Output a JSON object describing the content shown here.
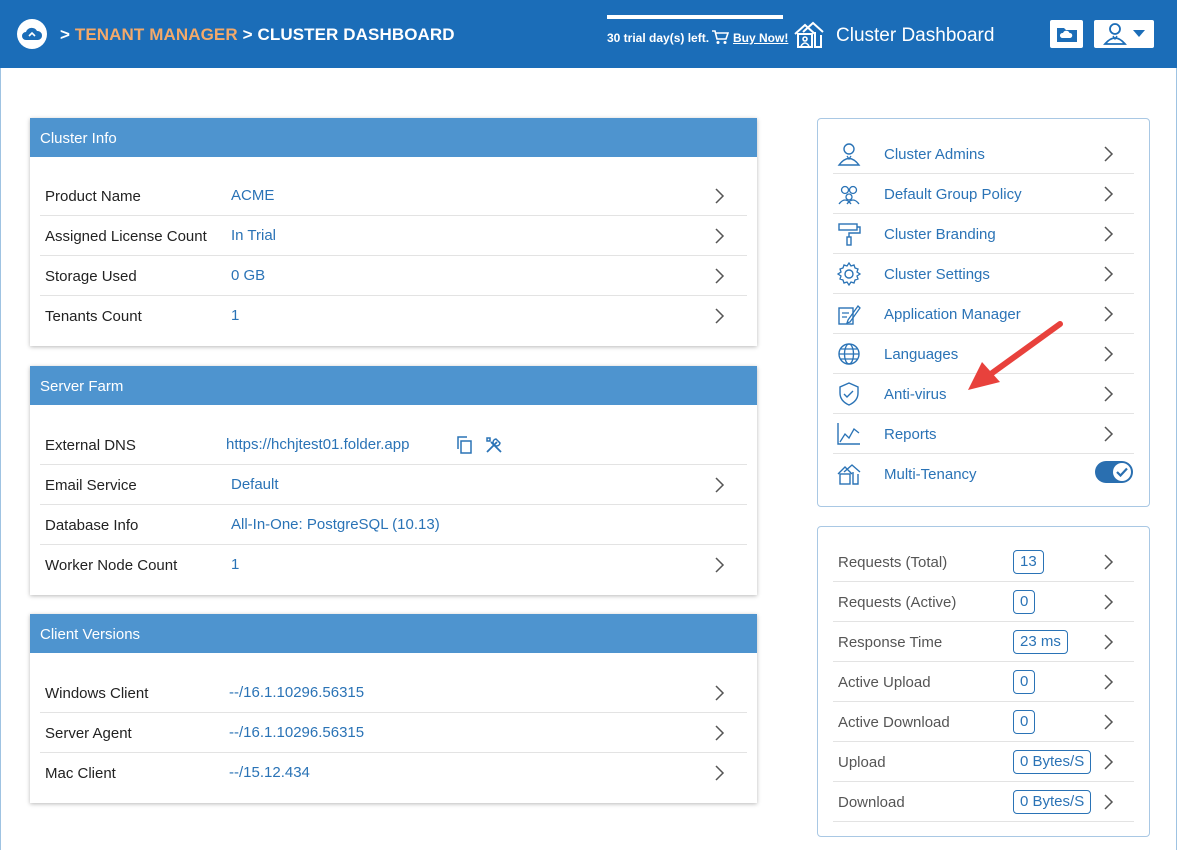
{
  "header": {
    "breadcrumb_sep1": ">",
    "breadcrumb_parent": "TENANT MANAGER",
    "breadcrumb_sep2": ">",
    "breadcrumb_current": "CLUSTER DASHBOARD",
    "trial_text": "30 trial day(s) left.",
    "buy_label": "Buy Now!",
    "title": "Cluster Dashboard",
    "icons": [
      "cloud-logo-icon",
      "cart-icon",
      "house-icon",
      "folder-icon",
      "user-icon",
      "caret-down-icon"
    ]
  },
  "cluster_info": {
    "title": "Cluster Info",
    "rows": [
      {
        "label": "Product Name",
        "value": "ACME"
      },
      {
        "label": "Assigned License Count",
        "value": "In Trial"
      },
      {
        "label": "Storage Used",
        "value": "0 GB"
      },
      {
        "label": "Tenants Count",
        "value": "1"
      }
    ]
  },
  "server_farm": {
    "title": "Server Farm",
    "rows": [
      {
        "label": "External DNS",
        "value": "https://hchjtest01.folder.app"
      },
      {
        "label": "Email Service",
        "value": "Default"
      },
      {
        "label": "Database Info",
        "value": "All-In-One: PostgreSQL (10.13)"
      },
      {
        "label": "Worker Node Count",
        "value": "1"
      }
    ]
  },
  "client_versions": {
    "title": "Client Versions",
    "rows": [
      {
        "label": "Windows Client",
        "value": "--/16.1.10296.56315"
      },
      {
        "label": "Server Agent",
        "value": "--/16.1.10296.56315"
      },
      {
        "label": "Mac Client",
        "value": "--/15.12.434"
      }
    ]
  },
  "menu": {
    "items": [
      {
        "label": "Cluster Admins",
        "icon": "admin-user-icon"
      },
      {
        "label": "Default Group Policy",
        "icon": "group-icon"
      },
      {
        "label": "Cluster Branding",
        "icon": "paint-roller-icon"
      },
      {
        "label": "Cluster Settings",
        "icon": "gear-icon"
      },
      {
        "label": "Application Manager",
        "icon": "app-manager-icon"
      },
      {
        "label": "Languages",
        "icon": "globe-icon"
      },
      {
        "label": "Anti-virus",
        "icon": "shield-icon"
      },
      {
        "label": "Reports",
        "icon": "chart-icon"
      },
      {
        "label": "Multi-Tenancy",
        "icon": "multi-tenancy-icon"
      }
    ],
    "multi_tenancy_enabled": true
  },
  "stats": {
    "items": [
      {
        "label": "Requests (Total)",
        "value": "13"
      },
      {
        "label": "Requests (Active)",
        "value": "0"
      },
      {
        "label": "Response Time",
        "value": "23 ms"
      },
      {
        "label": "Active Upload",
        "value": "0"
      },
      {
        "label": "Active Download",
        "value": "0"
      },
      {
        "label": "Upload",
        "value": "0 Bytes/S"
      },
      {
        "label": "Download",
        "value": "0 Bytes/S"
      }
    ]
  },
  "colors": {
    "header": "#1b6db8",
    "panel_header": "#4e94cf",
    "link": "#2a73b6",
    "breadcrumb_parent": "#f3a96a",
    "annotation_arrow": "#e8413c"
  }
}
